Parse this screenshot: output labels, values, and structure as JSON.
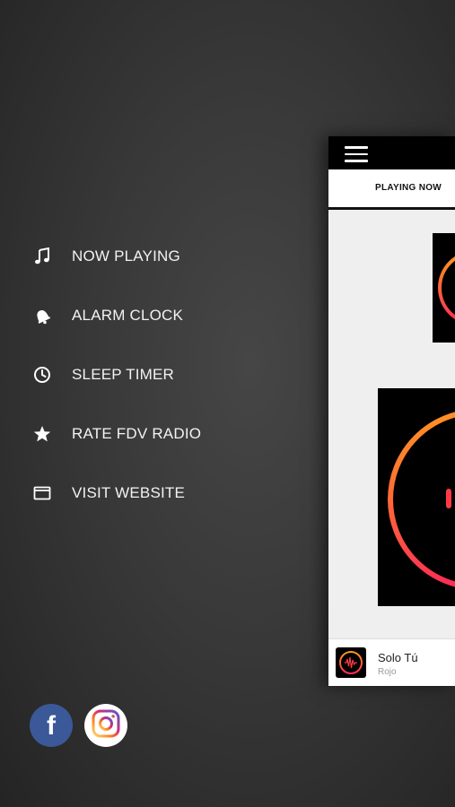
{
  "menu": {
    "items": [
      {
        "label": "NOW PLAYING",
        "icon": "music-note-icon"
      },
      {
        "label": "ALARM CLOCK",
        "icon": "bell-icon"
      },
      {
        "label": "SLEEP TIMER",
        "icon": "clock-icon"
      },
      {
        "label": "RATE FDV RADIO",
        "icon": "star-icon"
      },
      {
        "label": "VISIT WEBSITE",
        "icon": "browser-window-icon"
      }
    ]
  },
  "social": {
    "facebook_glyph": "f",
    "facebook_icon": "facebook-icon",
    "instagram_icon": "instagram-icon"
  },
  "app_preview": {
    "tab_label": "PLAYING NOW",
    "now_playing": {
      "title": "Solo Tú",
      "artist": "Rojo"
    }
  },
  "colors": {
    "background": "#383838",
    "facebook": "#3b5998",
    "ring_start": "#ff9a1f",
    "ring_end": "#ff2d55"
  }
}
